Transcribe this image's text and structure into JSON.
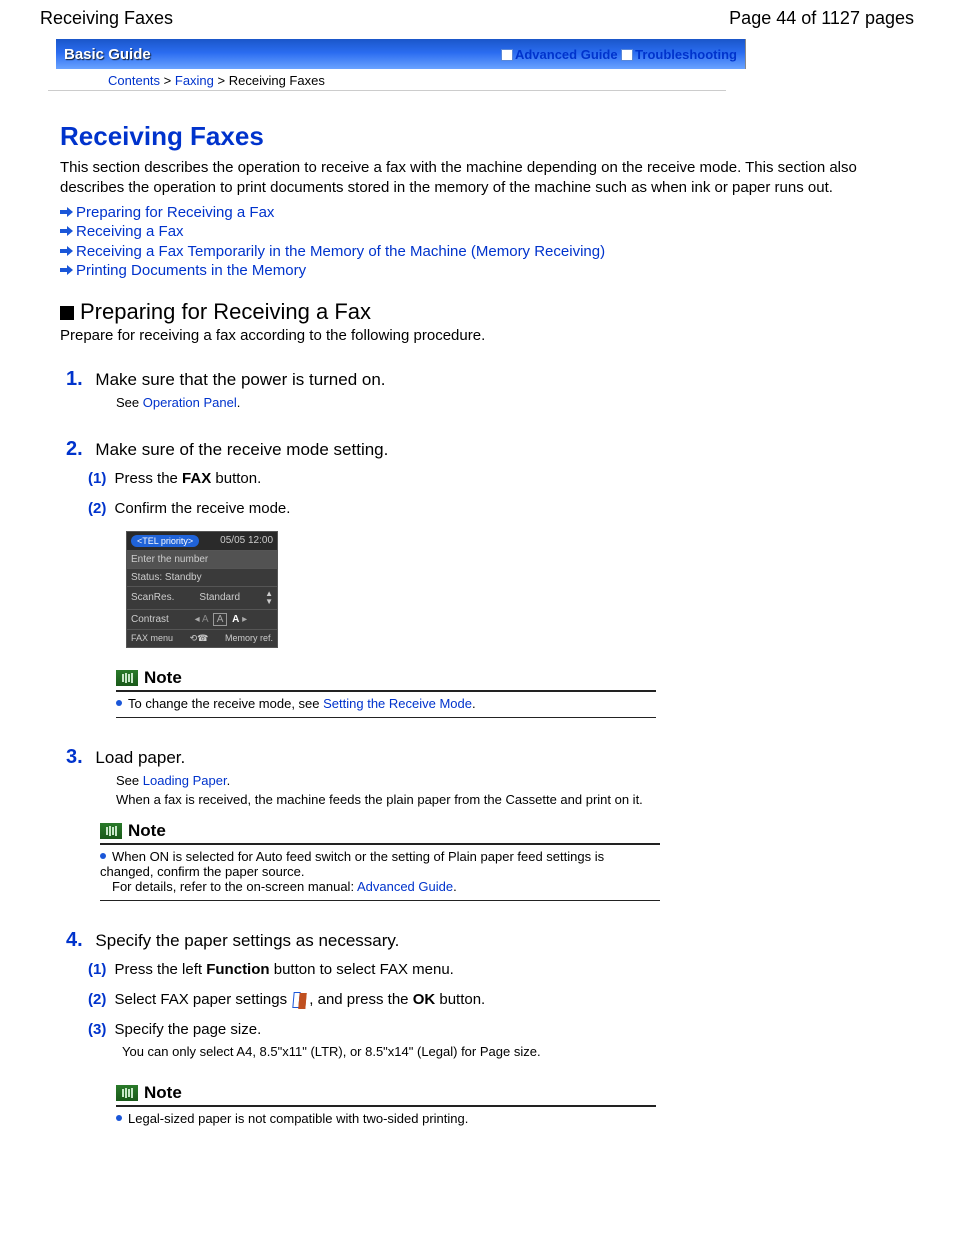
{
  "header": {
    "doc_title": "Receiving Faxes",
    "page_indicator": "Page 44 of 1127 pages"
  },
  "guide_bar": {
    "title": "Basic Guide",
    "link_advanced": "Advanced Guide",
    "link_troubleshooting": "Troubleshooting"
  },
  "breadcrumb": {
    "contents": "Contents",
    "faxing": "Faxing",
    "current": "Receiving Faxes"
  },
  "h1": "Receiving Faxes",
  "intro": "This section describes the operation to receive a fax with the machine depending on the receive mode. This section also describes the operation to print documents stored in the memory of the machine such as when ink or paper runs out.",
  "toc": [
    "Preparing for Receiving a Fax",
    "Receiving a Fax",
    "Receiving a Fax Temporarily in the Memory of the Machine (Memory Receiving)",
    "Printing Documents in the Memory"
  ],
  "h2_prepare": "Preparing for Receiving a Fax",
  "prepare_sub": "Prepare for receiving a fax according to the following procedure.",
  "step1": {
    "num": "1.",
    "text": "Make sure that the power is turned on.",
    "see_prefix": "See ",
    "see_link": "Operation Panel",
    "see_suffix": "."
  },
  "step2": {
    "num": "2.",
    "text": "Make sure of the receive mode setting.",
    "sub1_num": "(1)",
    "sub1_a": "Press the ",
    "sub1_b": "FAX",
    "sub1_c": " button.",
    "sub2_num": "(2)",
    "sub2_text": "Confirm the receive mode."
  },
  "lcd": {
    "tab": "<TEL priority>",
    "time": "05/05 12:00",
    "enter": "Enter the number",
    "status": "Status: Standby",
    "scanres_l": "ScanRes.",
    "scanres_v": "Standard",
    "contrast_l": "Contrast",
    "menu_l": "FAX menu",
    "menu_r": "Memory ref."
  },
  "note1": {
    "title": "Note",
    "text_a": "To change the receive mode, see ",
    "link": "Setting the Receive Mode",
    "text_b": "."
  },
  "step3": {
    "num": "3.",
    "text": "Load paper.",
    "see_prefix": "See ",
    "see_link": "Loading Paper",
    "see_suffix": ".",
    "desc": "When a fax is received, the machine feeds the plain paper from the Cassette and print on it."
  },
  "note2": {
    "title": "Note",
    "line1": "When ON is selected for Auto feed switch or the setting of Plain paper feed settings is changed, confirm the paper source.",
    "line2a": "For details, refer to the on-screen manual: ",
    "line2link": "Advanced Guide",
    "line2b": "."
  },
  "step4": {
    "num": "4.",
    "text": "Specify the paper settings as necessary.",
    "sub1_num": "(1)",
    "sub1_a": "Press the left ",
    "sub1_b": "Function",
    "sub1_c": " button to select FAX menu.",
    "sub2_num": "(2)",
    "sub2_a": "Select FAX paper settings ",
    "sub2_b": ", and press the ",
    "sub2_c": "OK",
    "sub2_d": " button.",
    "sub3_num": "(3)",
    "sub3_text": "Specify the page size.",
    "sub3_desc": "You can only select A4, 8.5\"x11\" (LTR), or 8.5\"x14\" (Legal) for Page size."
  },
  "note3": {
    "title": "Note",
    "text": "Legal-sized paper is not compatible with two-sided printing."
  }
}
